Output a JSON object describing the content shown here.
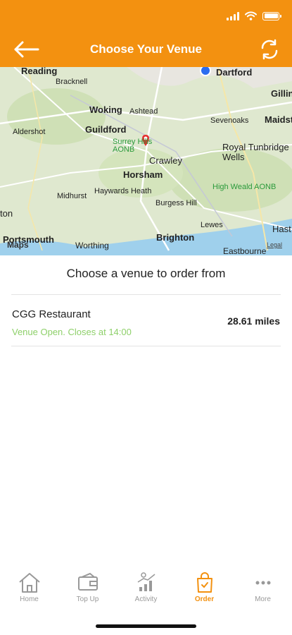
{
  "header": {
    "title": "Choose Your Venue",
    "back_icon": "back-arrow-icon",
    "refresh_icon": "refresh-icon",
    "color": "#f39110"
  },
  "map": {
    "places": [
      {
        "name": "Reading"
      },
      {
        "name": "Dartford"
      },
      {
        "name": "Bracknell"
      },
      {
        "name": "Gillin"
      },
      {
        "name": "Woking"
      },
      {
        "name": "Ashtead"
      },
      {
        "name": "Maidst"
      },
      {
        "name": "Aldershot"
      },
      {
        "name": "Guildford"
      },
      {
        "name": "Sevenoaks"
      },
      {
        "name": "Surrey Hills AONB"
      },
      {
        "name": "Royal Tunbridge Wells"
      },
      {
        "name": "Crawley"
      },
      {
        "name": "Horsham"
      },
      {
        "name": "High Weald AONB"
      },
      {
        "name": "Midhurst"
      },
      {
        "name": "Haywards Heath"
      },
      {
        "name": "Burgess Hill"
      },
      {
        "name": "Lewes"
      },
      {
        "name": "Brighton"
      },
      {
        "name": "Portsmouth"
      },
      {
        "name": "Worthing"
      },
      {
        "name": "Eastbourne"
      },
      {
        "name": "Hast"
      },
      {
        "name": "ton"
      }
    ],
    "attribution": "Maps",
    "legal": "Legal"
  },
  "content": {
    "heading": "Choose a venue to order from"
  },
  "venues": [
    {
      "name": "CGG Restaurant",
      "status": "Venue Open. Closes at 14:00",
      "distance": "28.61 miles",
      "status_color": "#8ed06a"
    }
  ],
  "tabs": [
    {
      "label": "Home",
      "icon": "home-icon",
      "active": false
    },
    {
      "label": "Top Up",
      "icon": "wallet-icon",
      "active": false
    },
    {
      "label": "Activity",
      "icon": "activity-chart-icon",
      "active": false
    },
    {
      "label": "Order",
      "icon": "shopping-bag-icon",
      "active": true
    },
    {
      "label": "More",
      "icon": "more-dots-icon",
      "active": false
    }
  ]
}
